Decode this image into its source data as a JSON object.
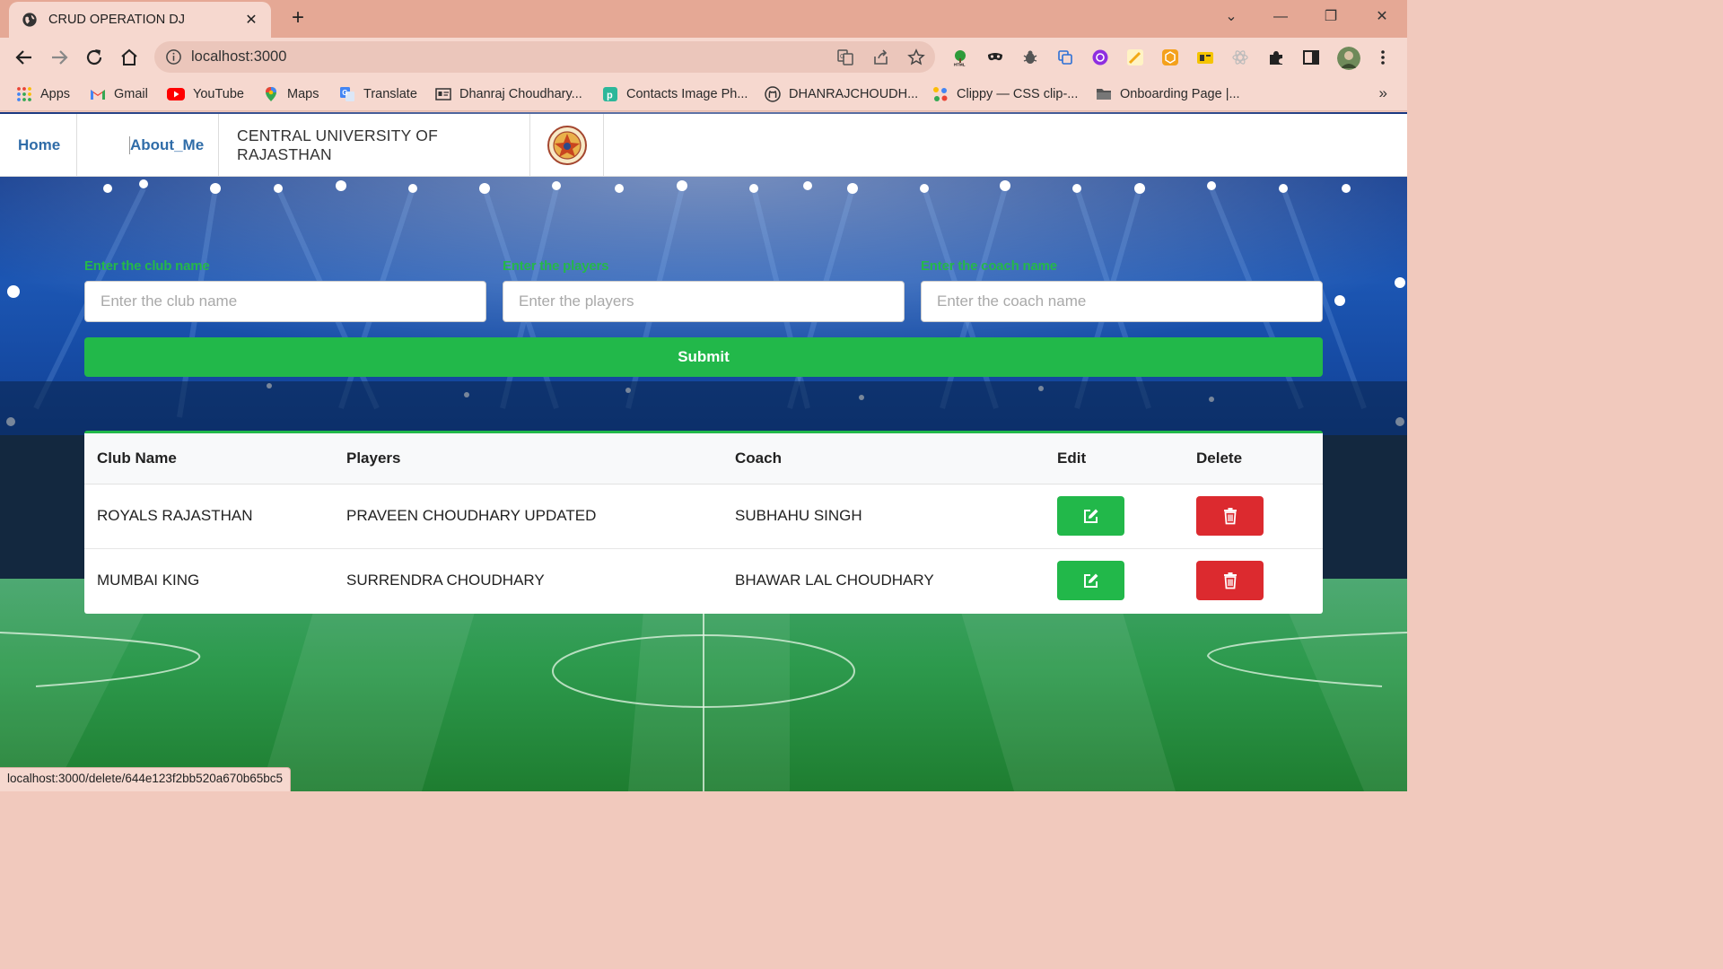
{
  "browser": {
    "tab_title": "CRUD OPERATION DJ",
    "tab_close": "✕",
    "new_tab": "+",
    "url": "localhost:3000",
    "window_controls": {
      "dropdown": "⌄",
      "minimize": "—",
      "restore": "❐",
      "close": "✕"
    },
    "bookmarks": [
      {
        "label": "Apps",
        "icon": "apps-grid-icon"
      },
      {
        "label": "Gmail",
        "icon": "gmail-icon"
      },
      {
        "label": "YouTube",
        "icon": "youtube-icon"
      },
      {
        "label": "Maps",
        "icon": "maps-icon"
      },
      {
        "label": "Translate",
        "icon": "translate-icon"
      },
      {
        "label": "Dhanraj Choudhary...",
        "icon": "profile-card-icon"
      },
      {
        "label": "Contacts Image Ph...",
        "icon": "contacts-icon"
      },
      {
        "label": "DHANRAJCHOUDH...",
        "icon": "github-icon"
      },
      {
        "label": "Clippy — CSS clip-...",
        "icon": "clippy-icon"
      },
      {
        "label": "Onboarding Page |...",
        "icon": "folder-icon"
      }
    ],
    "bookmarks_more": "»",
    "status_url": "localhost:3000/delete/644e123f2bb520a670b65bc5"
  },
  "nav": {
    "home": "Home",
    "about": "About_Me",
    "university": "CENTRAL UNIVERSITY OF RAJASTHAN"
  },
  "form": {
    "club_label": "Enter the club name",
    "club_placeholder": "Enter the club name",
    "players_label": "Enter the players",
    "players_placeholder": "Enter the players",
    "coach_label": "Enter the coach name",
    "coach_placeholder": "Enter the coach name",
    "submit": "Submit"
  },
  "table": {
    "headers": {
      "club": "Club Name",
      "players": "Players",
      "coach": "Coach",
      "edit": "Edit",
      "delete": "Delete"
    },
    "rows": [
      {
        "club": "ROYALS RAJASTHAN",
        "players": "PRAVEEN CHOUDHARY UPDATED",
        "coach": "SUBHAHU SINGH"
      },
      {
        "club": "MUMBAI KING",
        "players": "SURRENDRA CHOUDHARY",
        "coach": "BHAWAR LAL CHOUDHARY"
      }
    ]
  },
  "colors": {
    "accent_green": "#22b84a",
    "danger_red": "#dc2a2f",
    "link_blue": "#2f6ca8",
    "chrome_tabbar": "#e5a895",
    "chrome_toolbar": "#f6d8cf"
  }
}
